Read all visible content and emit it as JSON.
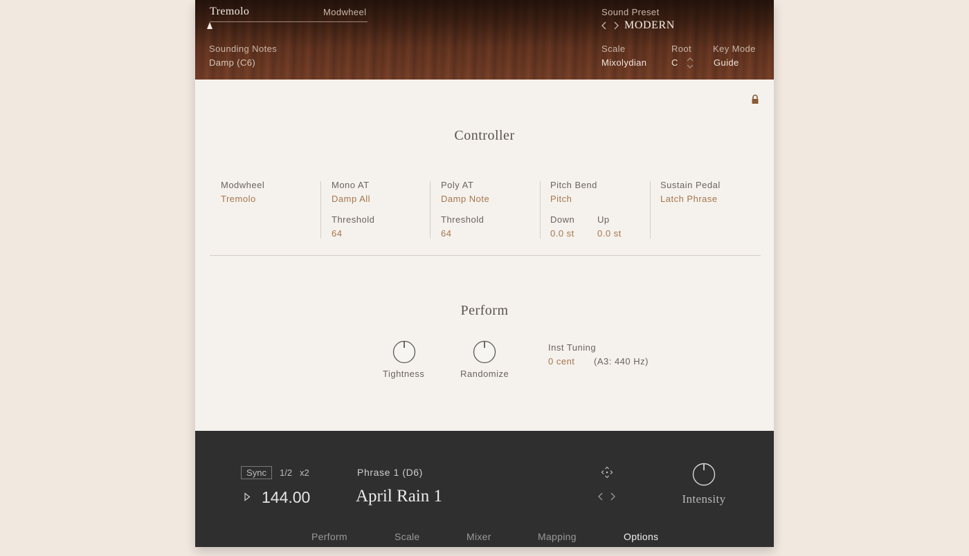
{
  "header": {
    "macro_name": "Tremolo",
    "macro_source": "Modwheel",
    "sounding_notes_label": "Sounding Notes",
    "sounding_notes_value": "Damp (C6)",
    "sound_preset_label": "Sound Preset",
    "sound_preset_value": "MODERN",
    "scale_label": "Scale",
    "scale_value": "Mixolydian",
    "root_label": "Root",
    "root_value": "C",
    "key_mode_label": "Key Mode",
    "key_mode_value": "Guide"
  },
  "controller": {
    "title": "Controller",
    "modwheel": {
      "label": "Modwheel",
      "value": "Tremolo"
    },
    "mono_at": {
      "label": "Mono AT",
      "value": "Damp All",
      "threshold_label": "Threshold",
      "threshold_value": "64"
    },
    "poly_at": {
      "label": "Poly AT",
      "value": "Damp Note",
      "threshold_label": "Threshold",
      "threshold_value": "64"
    },
    "pitch_bend": {
      "label": "Pitch Bend",
      "value": "Pitch",
      "down_label": "Down",
      "down_value": "0.0 st",
      "up_label": "Up",
      "up_value": "0.0 st"
    },
    "sustain_pedal": {
      "label": "Sustain Pedal",
      "value": "Latch Phrase"
    }
  },
  "perform": {
    "title": "Perform",
    "tightness_label": "Tightness",
    "randomize_label": "Randomize",
    "inst_tuning_label": "Inst Tuning",
    "inst_tuning_value": "0 cent",
    "inst_tuning_reference": "(A3: 440 Hz)"
  },
  "footer": {
    "sync_label": "Sync",
    "half_label": "1/2",
    "double_label": "x2",
    "tempo": "144.00",
    "phrase_label": "Phrase 1 (D6)",
    "phrase_name": "April Rain 1",
    "intensity_label": "Intensity",
    "tabs": [
      {
        "label": "Perform",
        "active": false
      },
      {
        "label": "Scale",
        "active": false
      },
      {
        "label": "Mixer",
        "active": false
      },
      {
        "label": "Mapping",
        "active": false
      },
      {
        "label": "Options",
        "active": true
      }
    ]
  },
  "colors": {
    "accent": "#a5754a",
    "footer_bg": "#2f2f2f",
    "panel_bg": "#f5f2ee",
    "page_bg": "#f1e8df"
  },
  "icons": [
    "triangle-slider-icon",
    "chevron-left-icon",
    "chevron-right-icon",
    "up-down-stepper-icon",
    "lock-icon",
    "play-icon",
    "move-icon",
    "knob-icon"
  ]
}
